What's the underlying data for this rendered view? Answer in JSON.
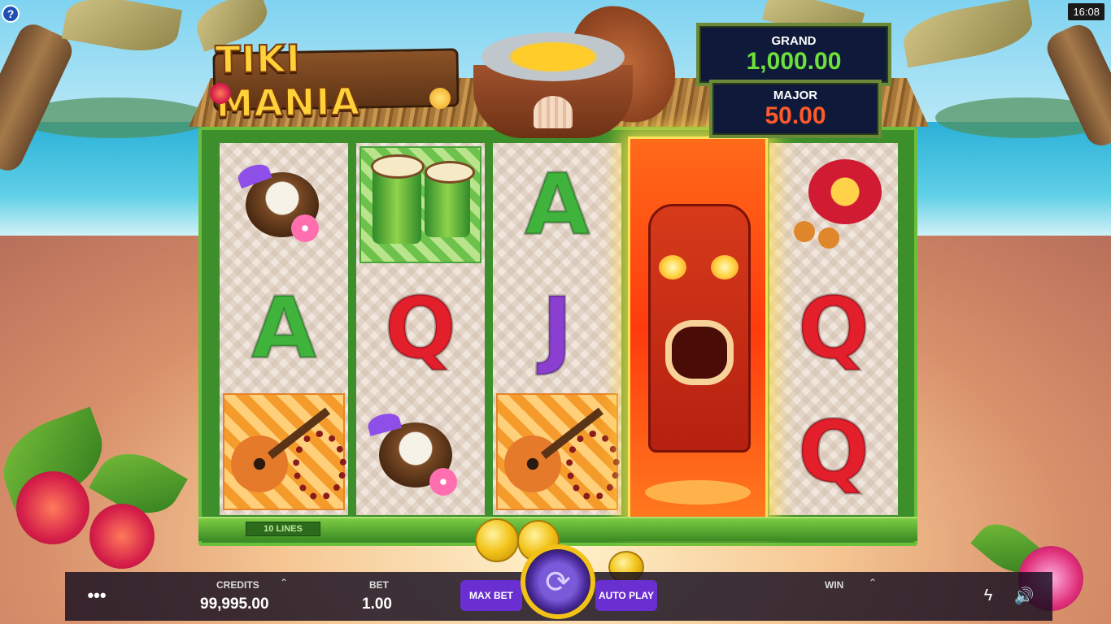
{
  "clock": "16:08",
  "logo": "TIKI MANIA",
  "jackpots": [
    {
      "label": "GRAND",
      "value": "1,000.00"
    },
    {
      "label": "MAJOR",
      "value": "50.00"
    }
  ],
  "lines_label": "10 LINES",
  "reels": [
    [
      "coconut-drink",
      "A",
      "ukulele"
    ],
    [
      "drums",
      "Q",
      "coconut-drink"
    ],
    [
      "A",
      "J",
      "ukulele"
    ],
    [
      "tiki-wild",
      "tiki-wild",
      "tiki-wild"
    ],
    [
      "lei-maracas",
      "Q",
      "Q"
    ]
  ],
  "letters": {
    "r1c2": "A",
    "r2c2": "Q",
    "r3c1": "A",
    "r3c2": "J",
    "r5c2": "Q",
    "r5c3": "Q"
  },
  "bottom_bar": {
    "credits_label": "CREDITS",
    "credits_value": "99,995.00",
    "bet_label": "BET",
    "bet_value": "1.00",
    "max_bet_label": "MAX BET",
    "auto_play_label": "AUTO PLAY",
    "win_label": "WIN",
    "menu_icon": "ellipsis-icon",
    "turbo_icon": "lightning-icon",
    "sound_icon": "speaker-icon",
    "spin_icon": "spin-arrow-icon"
  },
  "colors": {
    "grand_value": "#6ee03a",
    "major_value": "#ff5a2a",
    "bar_button": "#6a2fd0",
    "spin_ring": "#f2c218"
  }
}
